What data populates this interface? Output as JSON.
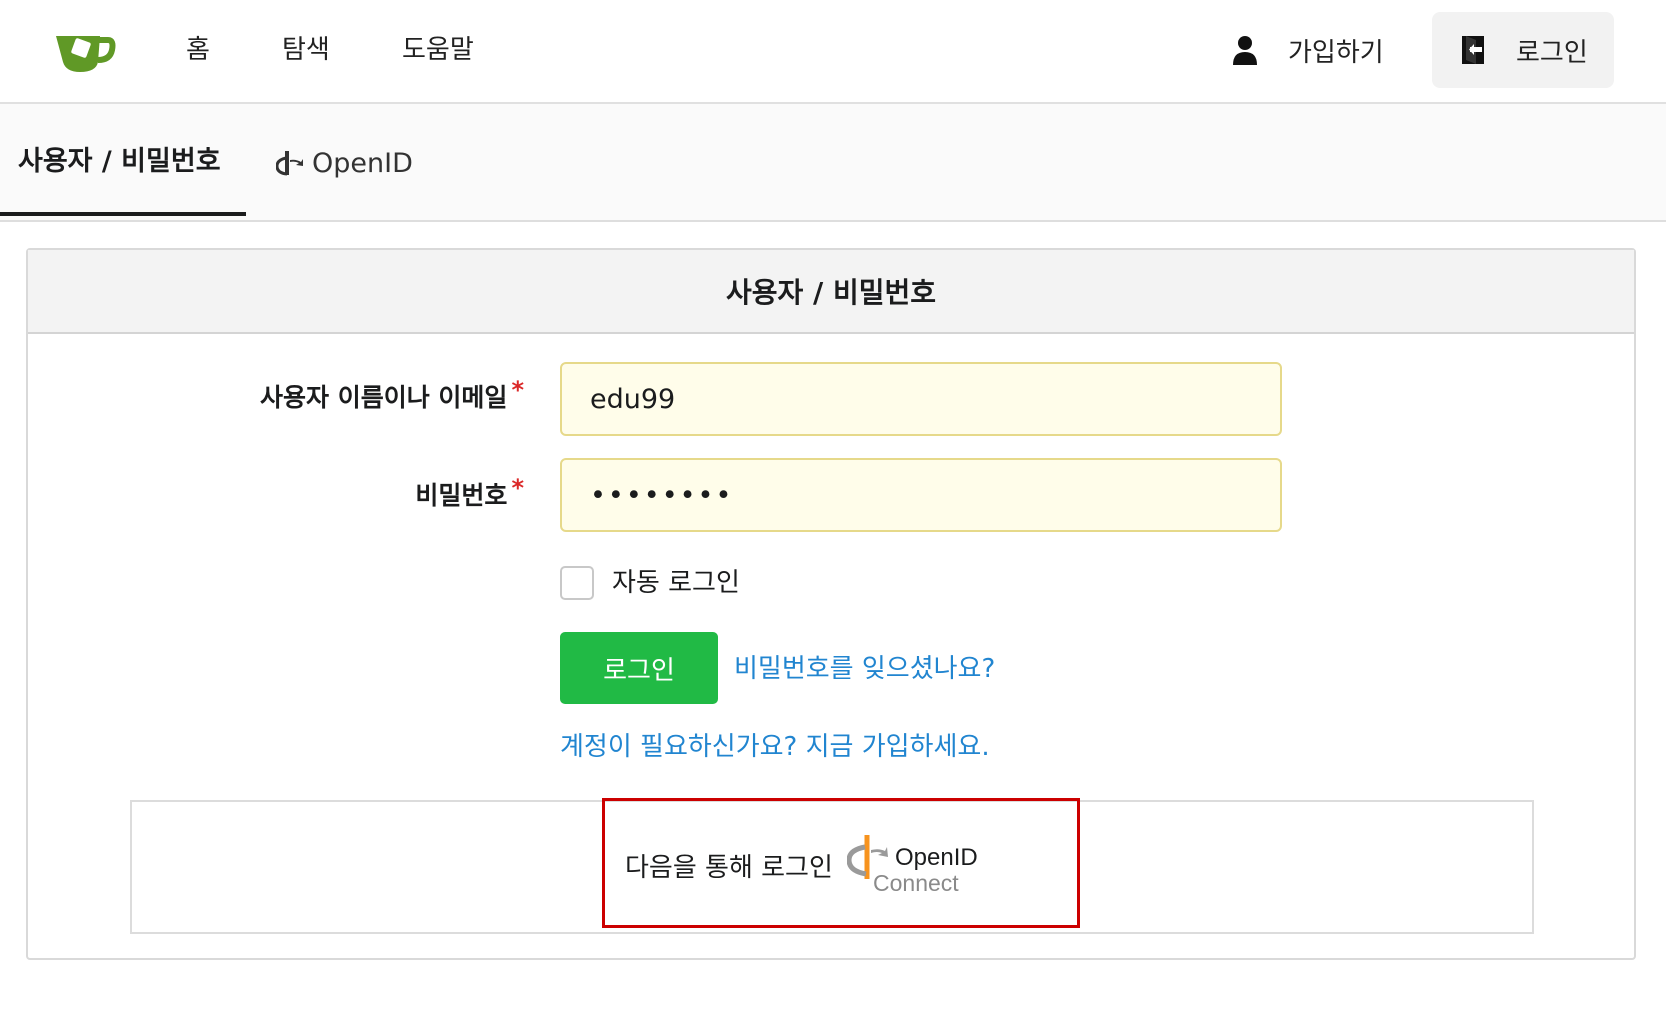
{
  "nav": {
    "home": "홈",
    "explore": "탐색",
    "help": "도움말",
    "register": "가입하기",
    "signin": "로그인"
  },
  "tabs": [
    {
      "label": "사용자 / 비밀번호",
      "active": true
    },
    {
      "label": "OpenID",
      "active": false
    }
  ],
  "card": {
    "title": "사용자 / 비밀번호",
    "username_label": "사용자 이름이나 이메일",
    "username_value": "edu99",
    "password_label": "비밀번호",
    "password_value": "••••••••",
    "required_mark": "*",
    "remember_label": "자동 로그인",
    "remember_checked": false,
    "login_button": "로그인",
    "forgot_link": "비밀번호를 잊으셨나요?",
    "register_link": "계정이 필요하신가요? 지금 가입하세요."
  },
  "oauth": {
    "text": "다음을 통해 로그인",
    "provider_title": "OpenID",
    "provider_subtitle": "Connect",
    "highlighted": true
  },
  "colors": {
    "accent_green": "#21ba45",
    "link_blue": "#2185d0",
    "logo_green": "#609926",
    "required_red": "#db2828",
    "highlight_red": "#cc0000",
    "input_bg": "#fffdea",
    "openid_orange": "#f7931e"
  },
  "icons": {
    "logo": "gitea-teacup-icon",
    "register": "user-icon",
    "signin": "sign-in-door-icon",
    "openid_tab": "openid-icon",
    "oauth_provider": "openid-connect-logo-icon"
  }
}
